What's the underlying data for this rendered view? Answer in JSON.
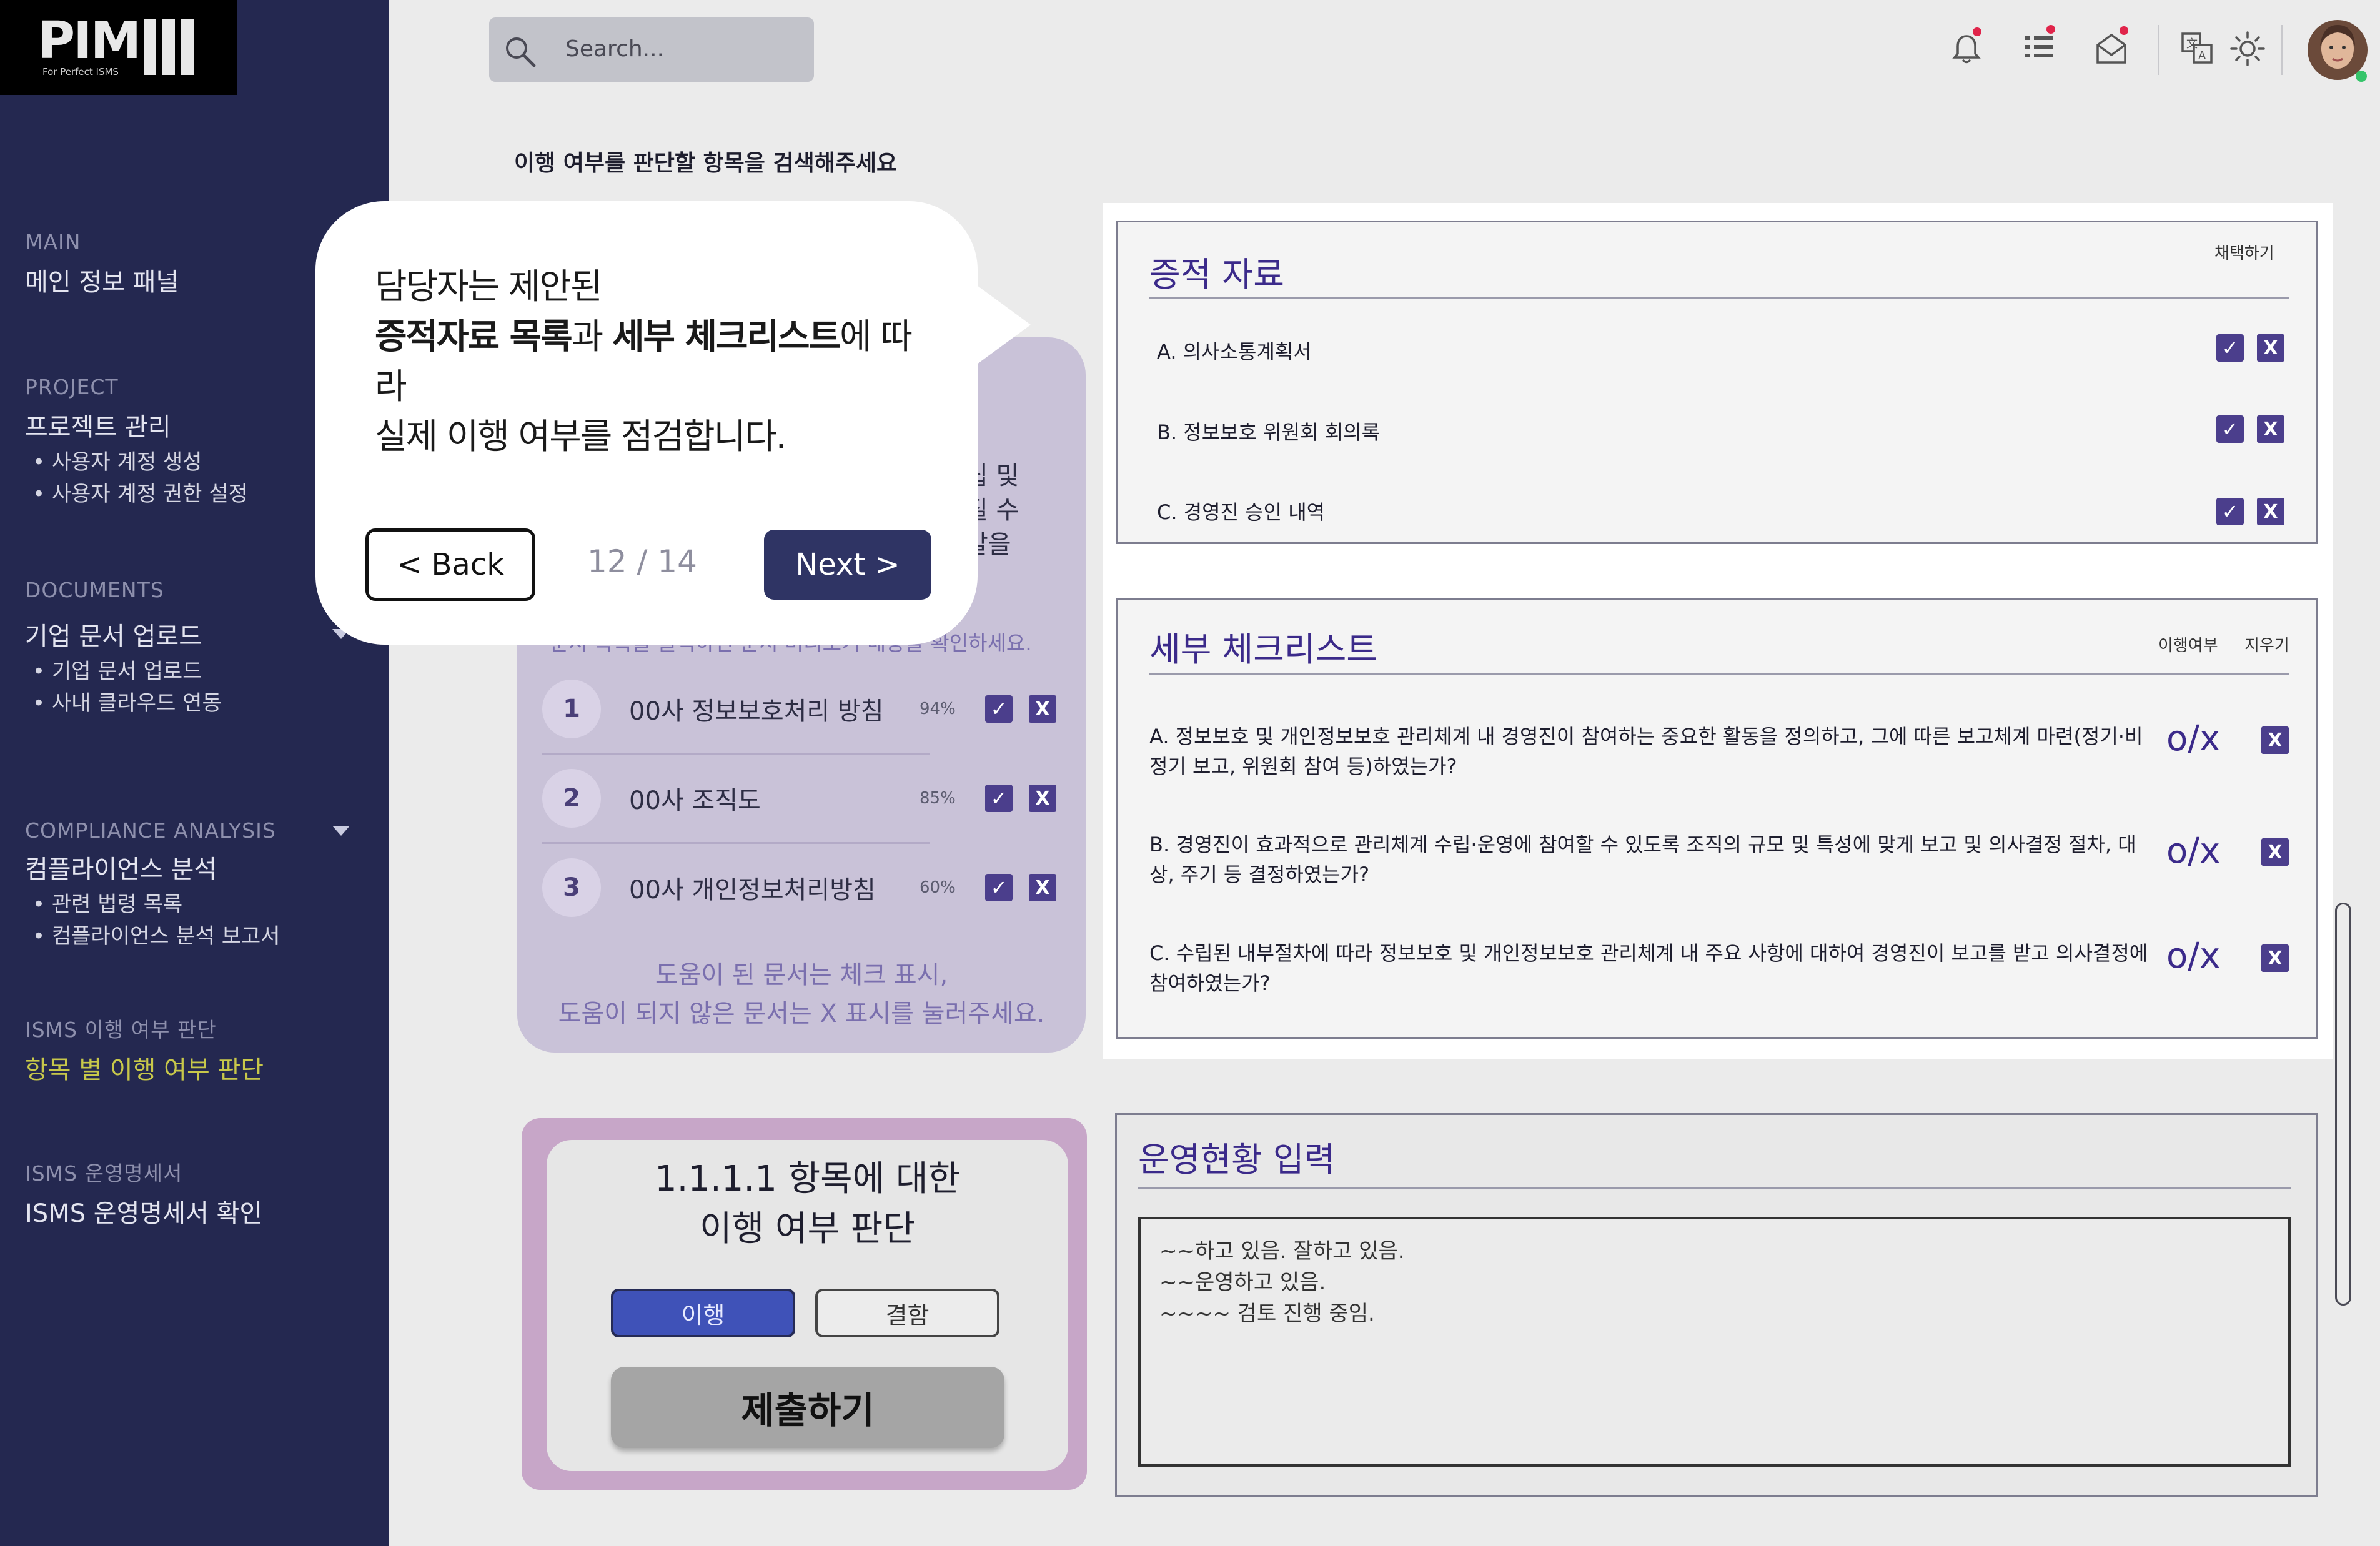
{
  "logo": {
    "name": "PIM",
    "tagline": "For Perfect ISMS"
  },
  "sidebar": {
    "sections": [
      {
        "label": "MAIN",
        "title": "메인 정보 패널",
        "items": []
      },
      {
        "label": "PROJECT",
        "title": "프로젝트 관리",
        "items": [
          "사용자 계정 생성",
          "사용자 계정 권한 설정"
        ]
      },
      {
        "label": "DOCUMENTS",
        "title": "기업 문서 업로드",
        "items": [
          "기업 문서 업로드",
          "사내 클라우드 연동"
        ]
      },
      {
        "label": "COMPLIANCE ANALYSIS",
        "title": "컴플라이언스 분석",
        "items": [
          "관련 법령 목록",
          "컴플라이언스 분석 보고서"
        ]
      },
      {
        "label": "ISMS 이행 여부 판단",
        "title": "항목 별 이행 여부 판단",
        "items": []
      },
      {
        "label": "ISMS 운영명세서",
        "title": "ISMS 운영명세서 확인",
        "items": []
      }
    ],
    "active_color": "#c8c84a"
  },
  "header": {
    "search_placeholder": "Search...",
    "icons": [
      "bell-icon",
      "list-icon",
      "mail-icon",
      "translate-icon",
      "sun-icon",
      "avatar"
    ]
  },
  "page_title": "이행 여부를 판단할 항목을 검색해주세요",
  "doc_panel": {
    "partial_text": [
      "립 및",
      "질 수",
      "갈을"
    ],
    "hint_top": "문서 목록을 클릭하면 문서 미리보기 내용을 확인하세요.",
    "docs": [
      {
        "num": "1",
        "name": "00사 정보보호처리 방침",
        "pct": "94%"
      },
      {
        "num": "2",
        "name": "00사 조직도",
        "pct": "85%"
      },
      {
        "num": "3",
        "name": "00사 개인정보처리방침",
        "pct": "60%"
      }
    ],
    "hint_bottom_1": "도움이 된 문서는 체크 표시,",
    "hint_bottom_2": "도움이 되지 않은 문서는 X 표시를 눌러주세요."
  },
  "decision": {
    "title_1": "1.1.1.1 항목에 대한",
    "title_2": "이행 여부 판단",
    "option_pass": "이행",
    "option_fail": "결함",
    "submit": "제출하기"
  },
  "evidence": {
    "title": "증적 자료",
    "adopt_label": "채택하기",
    "items": [
      "A.  의사소통계획서",
      "B. 정보보호 위원회 회의록",
      "C. 경영진 승인 내역"
    ]
  },
  "checklist": {
    "title": "세부 체크리스트",
    "col_status": "이행여부",
    "col_delete": "지우기",
    "items": [
      {
        "text": "A.  정보보호 및 개인정보보호 관리체계 내 경영진이 참여하는 중요한 활동을 정의하고, 그에 따른 보고체계 마련(정기·비정기 보고, 위원회 참여 등)하였는가?",
        "status": "o/x"
      },
      {
        "text": "B. 경영진이 효과적으로 관리체계 수립·운영에 참여할 수 있도록 조직의 규모 및 특성에 맞게 보고 및 의사결정 절차, 대상, 주기 등 결정하였는가?",
        "status": "o/x"
      },
      {
        "text": "C. 수립된 내부절차에 따라 정보보호 및 개인정보보호 관리체계 내 주요 사항에 대하여 경영진이 보고를 받고 의사결정에 참여하였는가?",
        "status": "o/x"
      }
    ]
  },
  "ops": {
    "title": "운영현황 입력",
    "lines": [
      "~~하고 있음. 잘하고 있음.",
      "~~운영하고 있음.",
      "~~~~ 검토 진행 중임."
    ]
  },
  "tutorial": {
    "line1": "담당자는 제안된",
    "bold1": "증적자료 목록",
    "mid": "과 ",
    "bold2": "세부 체크리스트",
    "tail": "에 따라",
    "line3": "실제 이행 여부를 점검합니다.",
    "back": "< Back",
    "page": "12 / 14",
    "next": "Next >"
  }
}
